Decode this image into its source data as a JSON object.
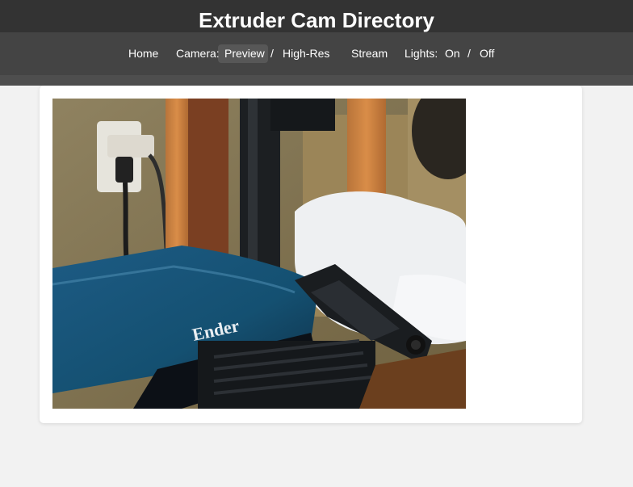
{
  "header": {
    "title": "Extruder Cam Directory"
  },
  "nav": {
    "home": "Home",
    "camera_label": "Camera:",
    "preview": "Preview",
    "sep1": "/",
    "highres": "High-Res",
    "stream": "Stream",
    "lights_label": "Lights:",
    "on": "On",
    "sep2": "/",
    "off": "Off"
  },
  "camera_feed": {
    "bed_brand_text": "Ender"
  },
  "colors": {
    "topbar": "#333333",
    "navbar": "#444444",
    "active_pill": "#575757",
    "page_bg": "#f2f2f2",
    "card_bg": "#ffffff"
  }
}
